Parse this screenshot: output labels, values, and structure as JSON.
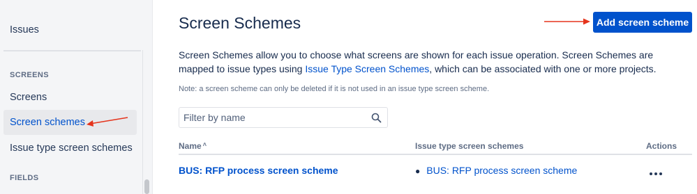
{
  "sidebar": {
    "title": "Issues",
    "sections": [
      {
        "label": "SCREENS"
      },
      {
        "label": "FIELDS"
      }
    ],
    "items": [
      {
        "label": "Screens",
        "selected": false
      },
      {
        "label": "Screen schemes",
        "selected": true
      },
      {
        "label": "Issue type screen schemes",
        "selected": false
      }
    ]
  },
  "header": {
    "title": "Screen Schemes",
    "add_button_label": "Add screen scheme"
  },
  "description": {
    "text_before": "Screen Schemes allow you to choose what screens are shown for each issue operation. Screen Schemes are mapped to issue types using ",
    "link_text": "Issue Type Screen Schemes",
    "text_after": ", which can be associated with one or more projects."
  },
  "note": "Note: a screen scheme can only be deleted if it is not used in an issue type screen scheme.",
  "filter": {
    "placeholder": "Filter by name",
    "value": ""
  },
  "table": {
    "columns": {
      "name": "Name",
      "name_sort_indicator": "˄",
      "schemes": "Issue type screen schemes",
      "actions": "Actions"
    },
    "rows": [
      {
        "name": "BUS: RFP process screen scheme",
        "schemes": [
          "BUS: RFP process screen scheme"
        ],
        "actions_icon": "more-icon"
      }
    ]
  },
  "colors": {
    "primary": "#0052cc",
    "link": "#0052cc",
    "text": "#172b4d",
    "subtle_text": "#5e6c84",
    "sidebar_bg": "#f4f5f7",
    "annotation_arrow": "#e5341c"
  }
}
